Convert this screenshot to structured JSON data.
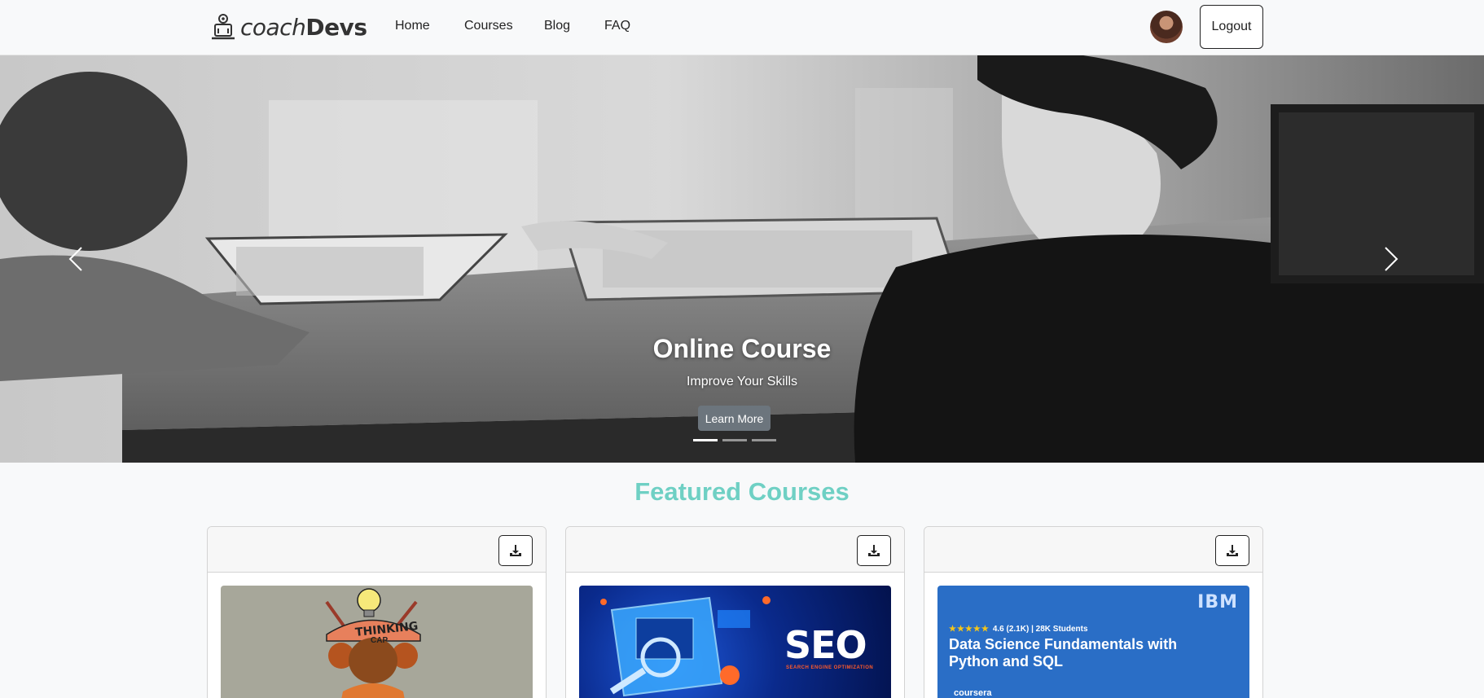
{
  "brand": {
    "part1": "coach",
    "part2": "Devs"
  },
  "nav": {
    "items": [
      {
        "label": "Home"
      },
      {
        "label": "Courses"
      },
      {
        "label": "Blog"
      },
      {
        "label": "FAQ"
      }
    ]
  },
  "user": {
    "logout_label": "Logout"
  },
  "hero": {
    "title": "Online Course",
    "subtitle": "Improve Your Skills",
    "button_label": "Learn More",
    "active_slide": 1,
    "slide_count": 3
  },
  "featured": {
    "title": "Featured Courses",
    "courses": [
      {
        "image_text": "THINKING",
        "image_text2": "CAP"
      },
      {
        "image_text": "SEO",
        "image_subtext": "SEARCH ENGINE OPTIMIZATION"
      },
      {
        "image_logo": "IBM",
        "image_rating": "4.6 (2.1K) | 28K Students",
        "image_title": "Data Science Fundamentals with Python and SQL",
        "image_provider": "coursera"
      }
    ]
  },
  "colors": {
    "accent": "#6fd0c4",
    "background": "#f8f9fa",
    "button_gray": "#6c757d"
  },
  "icons": {
    "download": "download-icon",
    "prev": "chevron-left-icon",
    "next": "chevron-right-icon"
  }
}
